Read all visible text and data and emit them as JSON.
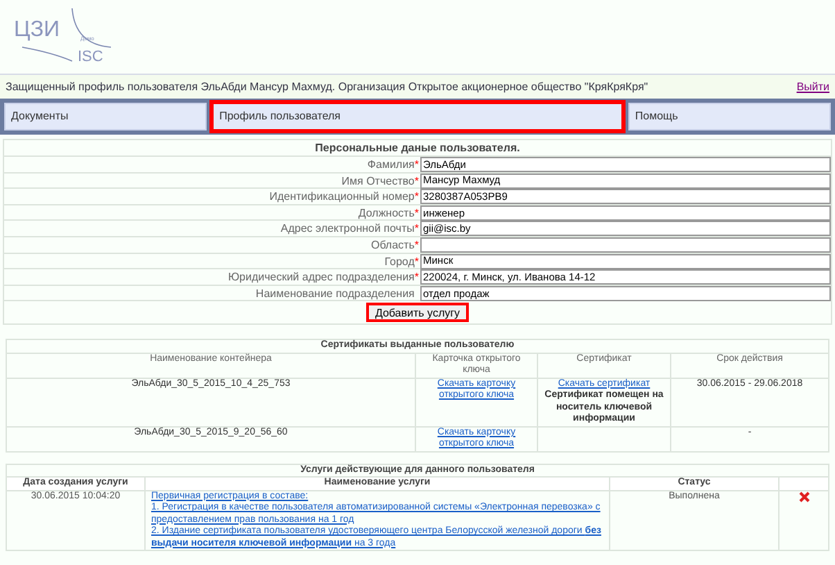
{
  "logo": {
    "main": "ЦЗИ",
    "sub": "ISC",
    "small": "Демо"
  },
  "header": {
    "text": "Защищенный профиль пользователя ЭльАбди Мансур Махмуд. Организация Открытое акционерное общество \"КряКряКря\"",
    "logout": "Выйти"
  },
  "tabs": [
    {
      "label": "Документы",
      "selected": false
    },
    {
      "label": "Профиль пользователя",
      "selected": true
    },
    {
      "label": "Помощь",
      "selected": false
    }
  ],
  "profile": {
    "required_mark": "*",
    "title": "Персональные даные пользователя.",
    "fields": [
      {
        "label": "Фамилия",
        "required": true,
        "value": "ЭльАбди"
      },
      {
        "label": "Имя Отчество",
        "required": true,
        "value": "Мансур Махмуд"
      },
      {
        "label": "Идентификационный номер",
        "required": true,
        "value": "3280387A053PB9"
      },
      {
        "label": "Должность",
        "required": true,
        "value": "инженер"
      },
      {
        "label": "Адрес электронной почты",
        "required": true,
        "value": "gii@isc.by"
      },
      {
        "label": "Область",
        "required": true
      },
      {
        "label": "Город",
        "required": true,
        "value": "Минск"
      },
      {
        "label": "Юридический адрес подразделения",
        "required": true,
        "value": "220024, г. Минск, ул. Иванова 14-12"
      },
      {
        "label": "Наименование подразделения",
        "required": false,
        "value": "отдел продаж"
      }
    ],
    "button": {
      "label": "Добавить услугу",
      "highlighted": true
    }
  },
  "certificates": {
    "title": "Сертификаты выданные пользователю",
    "columns": [
      "Наименование контейнера",
      "Карточка открытого ключа",
      "Сертификат",
      "Срок действия"
    ],
    "rows": [
      {
        "container": "ЭльАбди_30_5_2015_10_4_25_753",
        "card_link": "Скачать карточку открытого ключа",
        "cert_link": "Скачать сертификат",
        "cert_note": "Сертификат помещен на носитель ключевой информации",
        "validity": "30.06.2015 - 29.06.2018"
      },
      {
        "container": "ЭльАбди_30_5_2015_9_20_56_60",
        "card_link": "Скачать карточку открытого ключа",
        "validity": "-"
      }
    ]
  },
  "services": {
    "title": "Услуги действующие для данного пользователя",
    "columns": [
      "Дата создания услуги",
      "Наименование услуги",
      "Статус"
    ],
    "rows": [
      {
        "date": "30.06.2015 10:04:20",
        "lines": [
          "Первичная регистрация в составе:",
          "1. Регистрация в качестве пользователя автоматизированной системы «Электронная перевозка» с предоставлением прав пользования на 1 год",
          "2. Издание сертификата пользователя удостоверяющего центра Белорусской железной дороги **без выдачи носителя ключевой информации** на 3 года"
        ],
        "status": "Выполнена"
      }
    ]
  }
}
